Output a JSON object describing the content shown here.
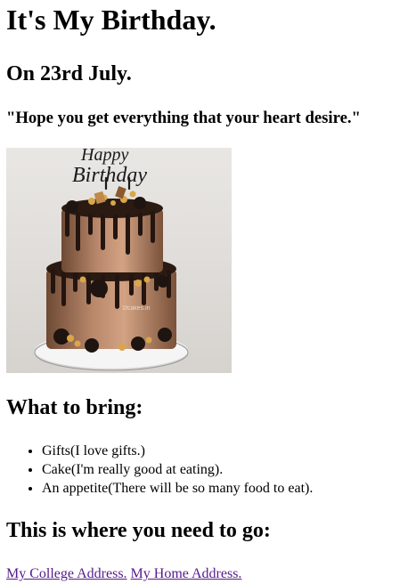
{
  "heading": "It's My Birthday.",
  "date_heading": "On 23rd July.",
  "quote": "\"Hope you get everything that your heart desire.\"",
  "image": {
    "alt": "Happy Birthday cake",
    "topper_text": "Happy Birthday",
    "watermark": "1fcakes.in"
  },
  "bring_heading": "What to bring:",
  "bring_items": [
    "Gifts(I love gifts.)",
    "Cake(I'm really good at eating).",
    "An appetite(There will be so many food to eat)."
  ],
  "where_heading": "This is where you need to go:",
  "links": {
    "college": "My College Address.",
    "home": "My Home Address."
  },
  "colors": {
    "link_visited": "#551a8b",
    "text": "#000000"
  }
}
